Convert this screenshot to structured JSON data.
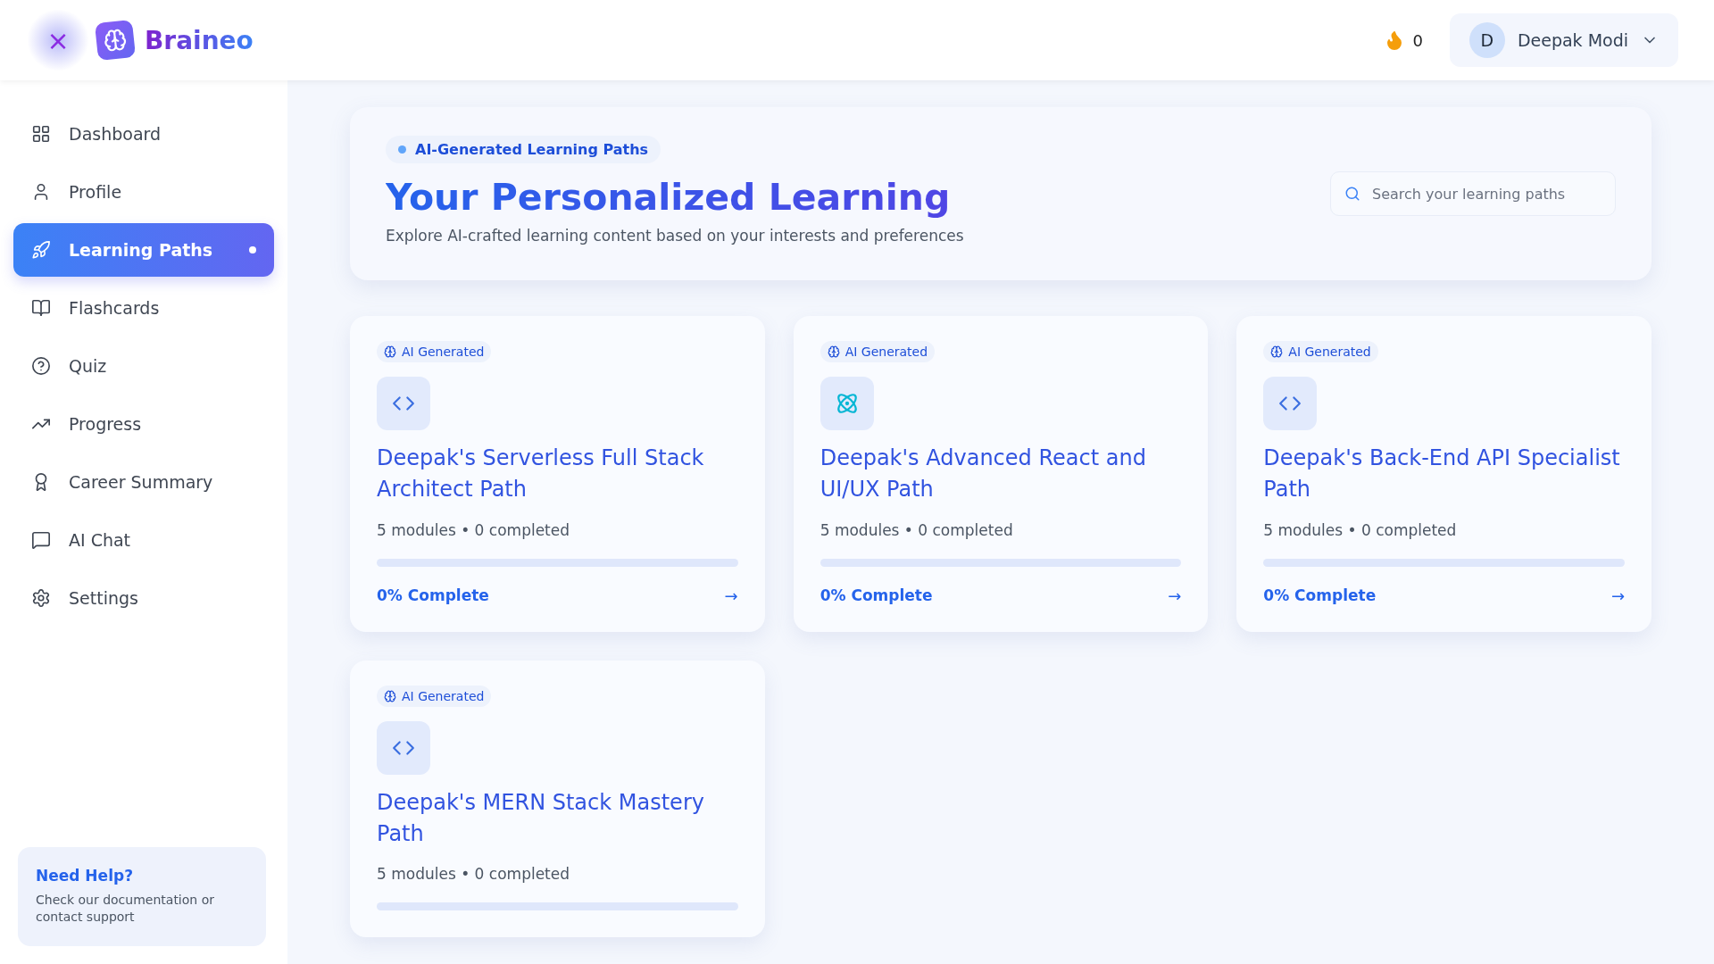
{
  "header": {
    "close_icon": "×",
    "logo": "Braineo",
    "streak": "0",
    "user": {
      "initial": "D",
      "name": "Deepak Modi"
    }
  },
  "sidebar": {
    "items": [
      {
        "label": "Dashboard",
        "kind": "dashboard",
        "selected": false
      },
      {
        "label": "Profile",
        "kind": "user",
        "selected": false
      },
      {
        "label": "Learning Paths",
        "kind": "rocket",
        "selected": true
      },
      {
        "label": "Flashcards",
        "kind": "book",
        "selected": false
      },
      {
        "label": "Quiz",
        "kind": "quiz",
        "selected": false
      },
      {
        "label": "Progress",
        "kind": "chart",
        "selected": false
      },
      {
        "label": "Career Summary",
        "kind": "award",
        "selected": false
      },
      {
        "label": "AI Chat",
        "kind": "chat",
        "selected": false
      },
      {
        "label": "Settings",
        "kind": "settings",
        "selected": false
      }
    ],
    "help": {
      "title": "Need Help?",
      "text": "Check our documentation or contact support"
    }
  },
  "hero": {
    "badge": "AI-Generated Learning Paths",
    "title": "Your Personalized Learning",
    "subtitle": "Explore AI-crafted learning content based on your interests and preferences",
    "search": {
      "placeholder": "Search your learning paths"
    }
  },
  "paths": [
    {
      "badge": "AI Generated",
      "kind": "code",
      "title": "Deepak's Serverless Full Stack Architect Path",
      "meta": "5 modules • 0 completed",
      "level": 0,
      "progress": "0% Complete",
      "arrow": "→"
    },
    {
      "badge": "AI Generated",
      "kind": "atom",
      "title": "Deepak's Advanced React and UI/UX Path",
      "meta": "5 modules • 0 completed",
      "level": 0,
      "progress": "0% Complete",
      "arrow": "→"
    },
    {
      "badge": "AI Generated",
      "kind": "code",
      "title": "Deepak's Back-End API Specialist Path",
      "meta": "5 modules • 0 completed",
      "level": 0,
      "progress": "0% Complete",
      "arrow": "→"
    },
    {
      "badge": "AI Generated",
      "kind": "code",
      "title": "Deepak's MERN Stack Mastery Path",
      "meta": "5 modules • 0 completed",
      "level": 0
    }
  ]
}
